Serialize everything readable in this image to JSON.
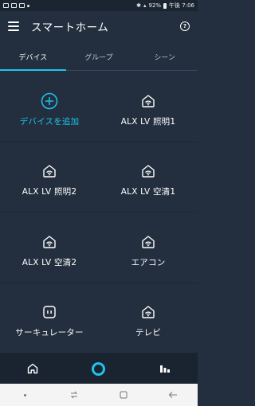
{
  "status_bar": {
    "time": "午後 7:06",
    "battery": "92%"
  },
  "app_bar": {
    "title": "スマートホーム",
    "help_icon": "help-circle-icon",
    "menu_icon": "hamburger-menu-icon"
  },
  "tabs": [
    {
      "label": "デバイス",
      "active": true
    },
    {
      "label": "グループ",
      "active": false
    },
    {
      "label": "シーン",
      "active": false
    }
  ],
  "devices": [
    {
      "label": "デバイスを追加",
      "icon": "add-circle-icon"
    },
    {
      "label": "ALX LV 照明1",
      "icon": "smart-home-device-icon"
    },
    {
      "label": "ALX LV 照明2",
      "icon": "smart-home-device-icon"
    },
    {
      "label": "ALX LV 空清1",
      "icon": "smart-home-device-icon"
    },
    {
      "label": "ALX LV 空清2",
      "icon": "smart-home-device-icon"
    },
    {
      "label": "エアコン",
      "icon": "smart-home-device-icon"
    },
    {
      "label": "サーキュレーター",
      "icon": "smart-plug-icon"
    },
    {
      "label": "テレビ",
      "icon": "smart-home-device-icon"
    }
  ],
  "bottom_nav": [
    "home-icon",
    "alexa-icon",
    "devices-icon"
  ],
  "colors": {
    "background": "#232f3e",
    "accent": "#1ec4ec",
    "bottom_bar": "#1a2330"
  }
}
